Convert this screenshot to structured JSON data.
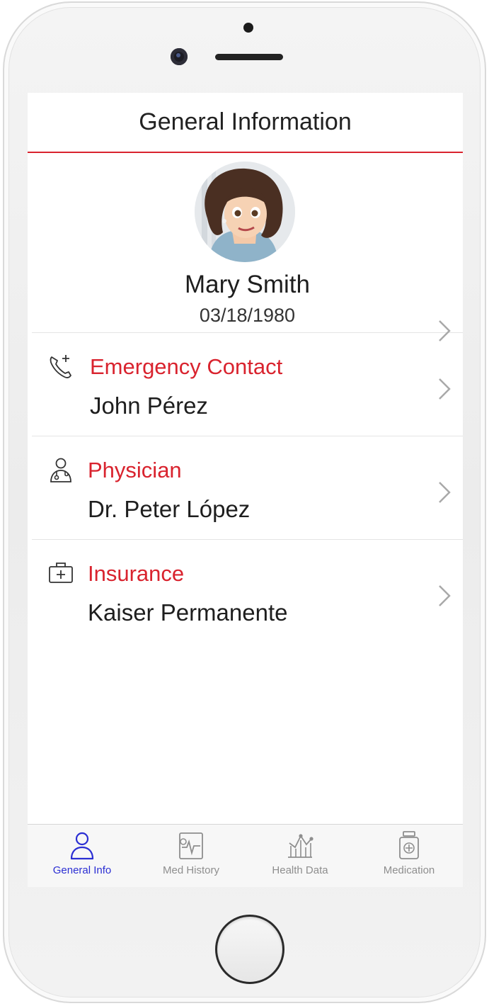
{
  "header": {
    "title": "General Information"
  },
  "profile": {
    "name": "Mary Smith",
    "dob": "03/18/1980",
    "avatar_icon": "avatar"
  },
  "rows": [
    {
      "title": "Emergency Contact",
      "value": "John Pérez",
      "icon": "phone-plus-icon"
    },
    {
      "title": "Physician",
      "value": "Dr. Peter López",
      "icon": "doctor-icon"
    },
    {
      "title": "Insurance",
      "value": "Kaiser Permanente",
      "icon": "medical-kit-icon"
    }
  ],
  "tabs": [
    {
      "label": "General Info",
      "icon": "person-icon",
      "active": true
    },
    {
      "label": "Med History",
      "icon": "clipboard-pulse-icon",
      "active": false
    },
    {
      "label": "Health Data",
      "icon": "chart-icon",
      "active": false
    },
    {
      "label": "Medication",
      "icon": "pill-bottle-icon",
      "active": false
    }
  ],
  "colors": {
    "accent": "#d9232e",
    "active_tab": "#2b2ed3",
    "inactive_tab": "#8e8e8e",
    "text": "#1e1e1e"
  }
}
